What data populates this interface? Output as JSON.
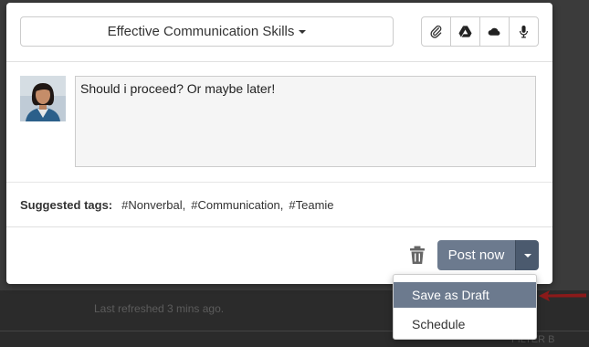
{
  "composer": {
    "course_select": {
      "label": "Effective Communication Skills"
    },
    "attachments": [
      {
        "icon": "paperclip-icon"
      },
      {
        "icon": "google-drive-icon"
      },
      {
        "icon": "onedrive-icon"
      },
      {
        "icon": "microphone-icon"
      }
    ],
    "post_text": "Should i proceed? Or maybe later!",
    "suggested_tags": {
      "label": "Suggested tags:",
      "tags": [
        "#Nonverbal,",
        "#Communication,",
        "#Teamie"
      ]
    },
    "actions": {
      "post_label": "Post now",
      "menu": [
        {
          "label": "Save as Draft",
          "highlighted": true
        },
        {
          "label": "Schedule",
          "highlighted": false
        }
      ]
    }
  },
  "background": {
    "last_refreshed": "Last refreshed 3 mins ago.",
    "partial_text": "FILTER B"
  },
  "colors": {
    "button": "#6c7a8e",
    "button_dark": "#4b5a6e",
    "arrow": "#8b1a1a"
  }
}
